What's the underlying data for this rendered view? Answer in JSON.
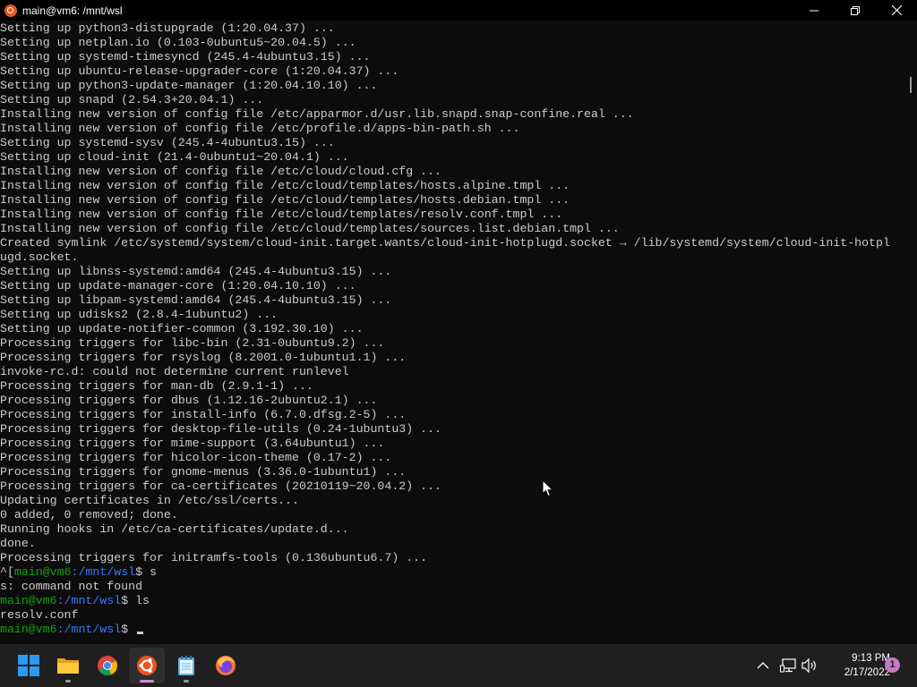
{
  "window": {
    "title": "main@vm6: /mnt/wsl",
    "controls": [
      "minimize",
      "maximize",
      "close"
    ]
  },
  "terminal": {
    "lines": [
      "Setting up python3-distupgrade (1:20.04.37) ...",
      "Setting up netplan.io (0.103-0ubuntu5~20.04.5) ...",
      "Setting up systemd-timesyncd (245.4-4ubuntu3.15) ...",
      "Setting up ubuntu-release-upgrader-core (1:20.04.37) ...",
      "Setting up python3-update-manager (1:20.04.10.10) ...",
      "Setting up snapd (2.54.3+20.04.1) ...",
      "Installing new version of config file /etc/apparmor.d/usr.lib.snapd.snap-confine.real ...",
      "Installing new version of config file /etc/profile.d/apps-bin-path.sh ...",
      "Setting up systemd-sysv (245.4-4ubuntu3.15) ...",
      "Setting up cloud-init (21.4-0ubuntu1~20.04.1) ...",
      "Installing new version of config file /etc/cloud/cloud.cfg ...",
      "Installing new version of config file /etc/cloud/templates/hosts.alpine.tmpl ...",
      "Installing new version of config file /etc/cloud/templates/hosts.debian.tmpl ...",
      "Installing new version of config file /etc/cloud/templates/resolv.conf.tmpl ...",
      "Installing new version of config file /etc/cloud/templates/sources.list.debian.tmpl ...",
      "Created symlink /etc/systemd/system/cloud-init.target.wants/cloud-init-hotplugd.socket → /lib/systemd/system/cloud-init-hotpl",
      "ugd.socket.",
      "Setting up libnss-systemd:amd64 (245.4-4ubuntu3.15) ...",
      "Setting up update-manager-core (1:20.04.10.10) ...",
      "Setting up libpam-systemd:amd64 (245.4-4ubuntu3.15) ...",
      "Setting up udisks2 (2.8.4-1ubuntu2) ...",
      "Setting up update-notifier-common (3.192.30.10) ...",
      "Processing triggers for libc-bin (2.31-0ubuntu9.2) ...",
      "Processing triggers for rsyslog (8.2001.0-1ubuntu1.1) ...",
      "invoke-rc.d: could not determine current runlevel",
      "Processing triggers for man-db (2.9.1-1) ...",
      "Processing triggers for dbus (1.12.16-2ubuntu2.1) ...",
      "Processing triggers for install-info (6.7.0.dfsg.2-5) ...",
      "Processing triggers for desktop-file-utils (0.24-1ubuntu3) ...",
      "Processing triggers for mime-support (3.64ubuntu1) ...",
      "Processing triggers for hicolor-icon-theme (0.17-2) ...",
      "Processing triggers for gnome-menus (3.36.0-1ubuntu1) ...",
      "Processing triggers for ca-certificates (20210119~20.04.2) ...",
      "Updating certificates in /etc/ssl/certs...",
      "0 added, 0 removed; done.",
      "Running hooks in /etc/ca-certificates/update.d...",
      "done.",
      "Processing triggers for initramfs-tools (0.136ubuntu6.7) ..."
    ],
    "prompt_lines": [
      {
        "prefix": "^[",
        "user": "main@vm6",
        "path": ":/mnt/wsl",
        "symbol": "$ ",
        "command": "s"
      },
      {
        "output": "s: command not found"
      },
      {
        "prefix": "",
        "user": "main@vm6",
        "path": ":/mnt/wsl",
        "symbol": "$ ",
        "command": "ls"
      },
      {
        "output": "resolv.conf"
      },
      {
        "prefix": "",
        "user": "main@vm6",
        "path": ":/mnt/wsl",
        "symbol": "$ ",
        "command": ""
      }
    ],
    "colors": {
      "text": "#cccccc",
      "user": "#13a10e",
      "path": "#3b78ff",
      "background": "#0c0c0c"
    }
  },
  "taskbar": {
    "apps": [
      {
        "name": "start-button",
        "icon": "windows-logo-icon"
      },
      {
        "name": "file-explorer",
        "icon": "folder-icon",
        "running": true
      },
      {
        "name": "chrome",
        "icon": "chrome-icon"
      },
      {
        "name": "ubuntu-terminal",
        "icon": "ubuntu-icon",
        "running": true,
        "active": true
      },
      {
        "name": "notepad",
        "icon": "notepad-icon",
        "running": true
      },
      {
        "name": "firefox",
        "icon": "firefox-icon"
      }
    ],
    "tray": [
      "chevron-up-icon",
      "network-icon",
      "volume-icon"
    ],
    "clock": {
      "time": "9:13 PM",
      "date": "2/17/2022"
    },
    "notification_count": "1"
  }
}
